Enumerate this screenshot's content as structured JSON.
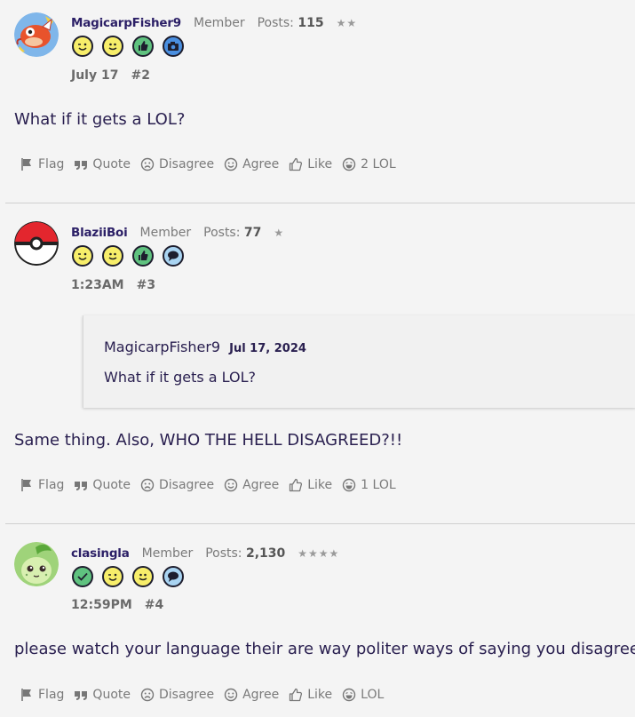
{
  "actions": {
    "flag": "Flag",
    "quote": "Quote",
    "disagree": "Disagree",
    "agree": "Agree",
    "like": "Like"
  },
  "posts": [
    {
      "username": "MagicarpFisher9",
      "role": "Member",
      "posts_label": "Posts:",
      "posts_count": "115",
      "stars": "★★",
      "date": "July 17",
      "number": "#2",
      "body": "What if it gets a LOL?",
      "lol": "2 LOL",
      "badges": [
        "wink-badge",
        "smile-badge",
        "thumbs-up-badge",
        "camera-badge"
      ]
    },
    {
      "username": "BlaziiBoi",
      "role": "Member",
      "posts_label": "Posts:",
      "posts_count": "77",
      "stars": "★",
      "date": "1:23AM",
      "number": "#3",
      "quote": {
        "user": "MagicarpFisher9",
        "date": "Jul 17, 2024",
        "text": "What if it gets a LOL?"
      },
      "body": "Same thing. Also, WHO THE HELL DISAGREED?!!",
      "lol": "1 LOL",
      "badges": [
        "wink-badge",
        "smile-badge",
        "thumbs-up-badge",
        "speech-badge"
      ]
    },
    {
      "username": "clasingla",
      "role": "Member",
      "posts_label": "Posts:",
      "posts_count": "2,130",
      "stars": "★★★★",
      "date": "12:59PM",
      "number": "#4",
      "body": "please watch your language their are way politer ways of saying you disagree",
      "lol": "LOL",
      "badges": [
        "check-badge",
        "wink-badge",
        "smile-badge",
        "speech-badge"
      ]
    }
  ],
  "colors": {
    "username": "#2b1f66",
    "badge_yellow": "#f7ee6a",
    "badge_green": "#5fc27f",
    "badge_blue": "#4a8fe0",
    "badge_lightblue": "#a9d4f2"
  }
}
